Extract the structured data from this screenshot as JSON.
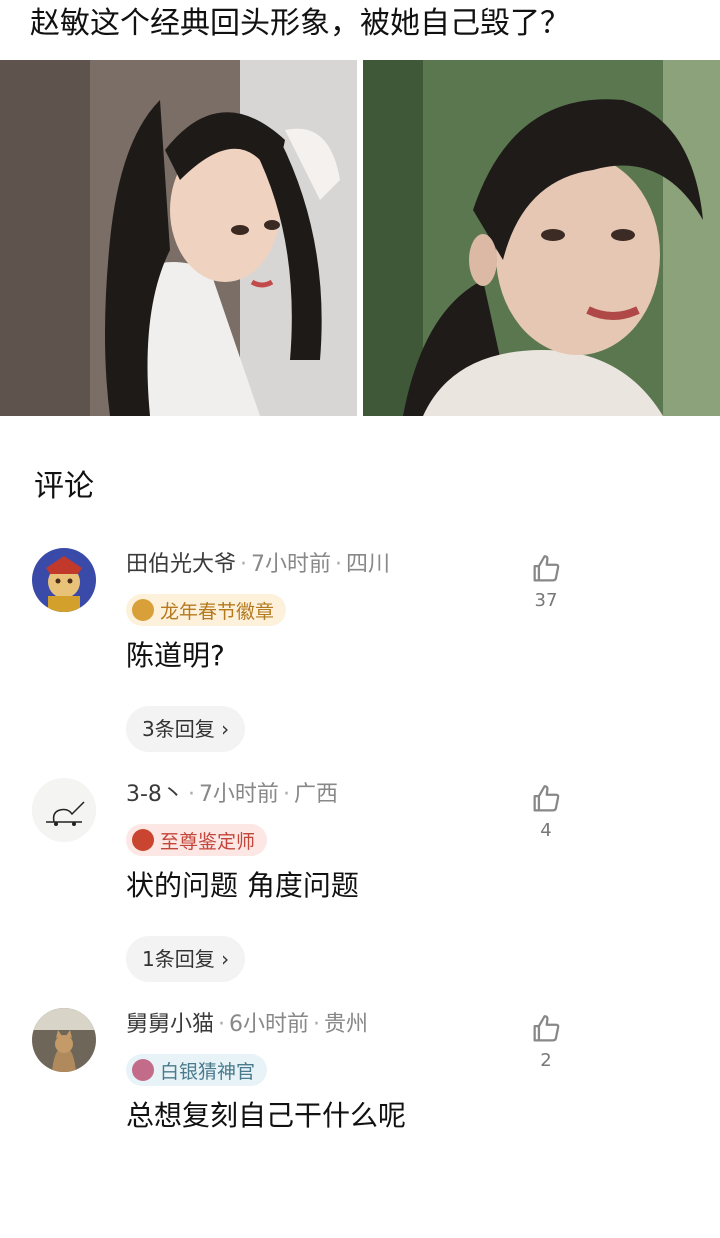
{
  "post": {
    "title": "赵敏这个经典回头形象，被她自己毁了？"
  },
  "comments_section": {
    "heading": "评论"
  },
  "comments": [
    {
      "user": "田伯光大爷",
      "time": "7小时前",
      "location": "四川",
      "badge": "龙年春节徽章",
      "text": "陈道明?",
      "replies": "3条回复 ›",
      "likes": "37"
    },
    {
      "user": "3-8丶",
      "time": "7小时前",
      "location": "广西",
      "badge": "至尊鉴定师",
      "text": "状的问题 角度问题",
      "replies": "1条回复 ›",
      "likes": "4"
    },
    {
      "user": "舅舅小猫",
      "time": "6小时前",
      "location": "贵州",
      "badge": "白银猜神官",
      "text": "总想复刻自己干什么呢",
      "likes": "2"
    }
  ],
  "colors": {
    "badge_gold_bg": "#fdf1dc",
    "badge_gold_text": "#b57a1e",
    "badge_red_bg": "#fde7e4",
    "badge_red_text": "#c2453a",
    "badge_silver_bg": "#e8f3f8",
    "badge_silver_text": "#4a7a8c"
  },
  "icons": {
    "like": "thumbs-up-icon"
  }
}
